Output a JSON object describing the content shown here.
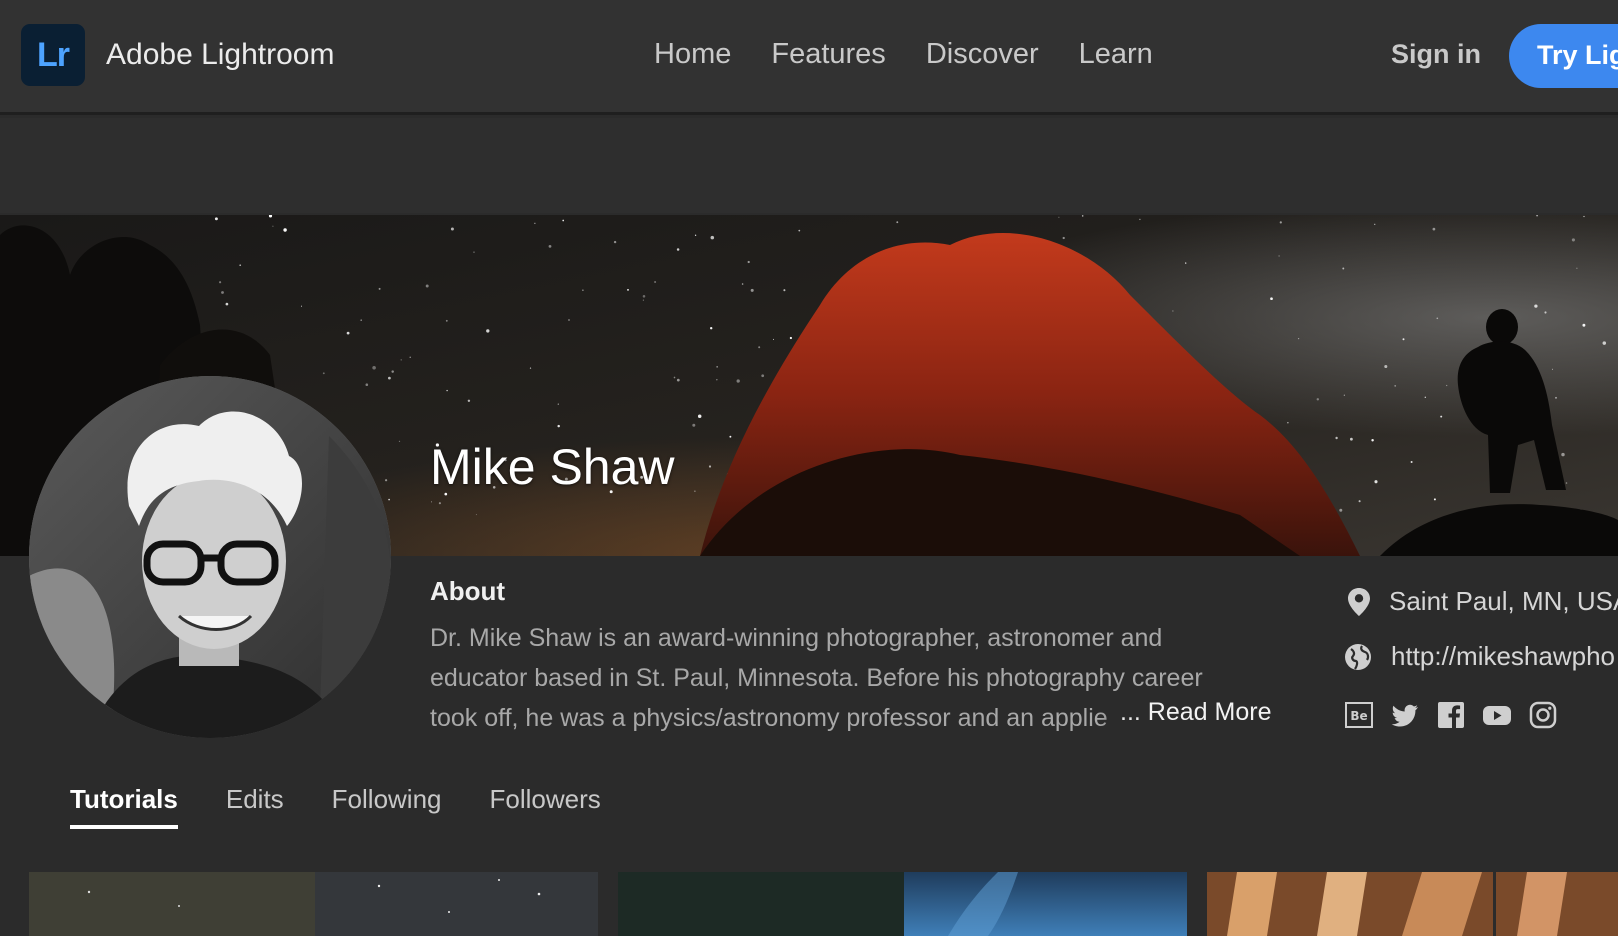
{
  "header": {
    "logo_text": "Lr",
    "app_name": "Adobe Lightroom",
    "nav": [
      "Home",
      "Features",
      "Discover",
      "Learn"
    ],
    "sign_in": "Sign in",
    "cta": "Try Lig"
  },
  "profile": {
    "name": "Mike Shaw",
    "about_title": "About",
    "about_text": "Dr. Mike Shaw is an award-winning photographer, astronomer and educator based in St. Paul, Minnesota. Before his photography career took off, he was a physics/astronomy professor and an applie",
    "ellipsis": "...",
    "read_more": "Read More",
    "location": "Saint Paul, MN, USA",
    "website": "http://mikeshawpho",
    "social_icons": [
      "behance-icon",
      "twitter-icon",
      "facebook-icon",
      "youtube-icon",
      "instagram-icon"
    ]
  },
  "tabs": [
    "Tutorials",
    "Edits",
    "Following",
    "Followers"
  ],
  "active_tab": "Tutorials",
  "colors": {
    "accent": "#3d88ef",
    "background": "#2b2b2b",
    "topbar": "#323232",
    "logo_bg": "#0a1f33",
    "logo_text": "#4da3ff"
  }
}
